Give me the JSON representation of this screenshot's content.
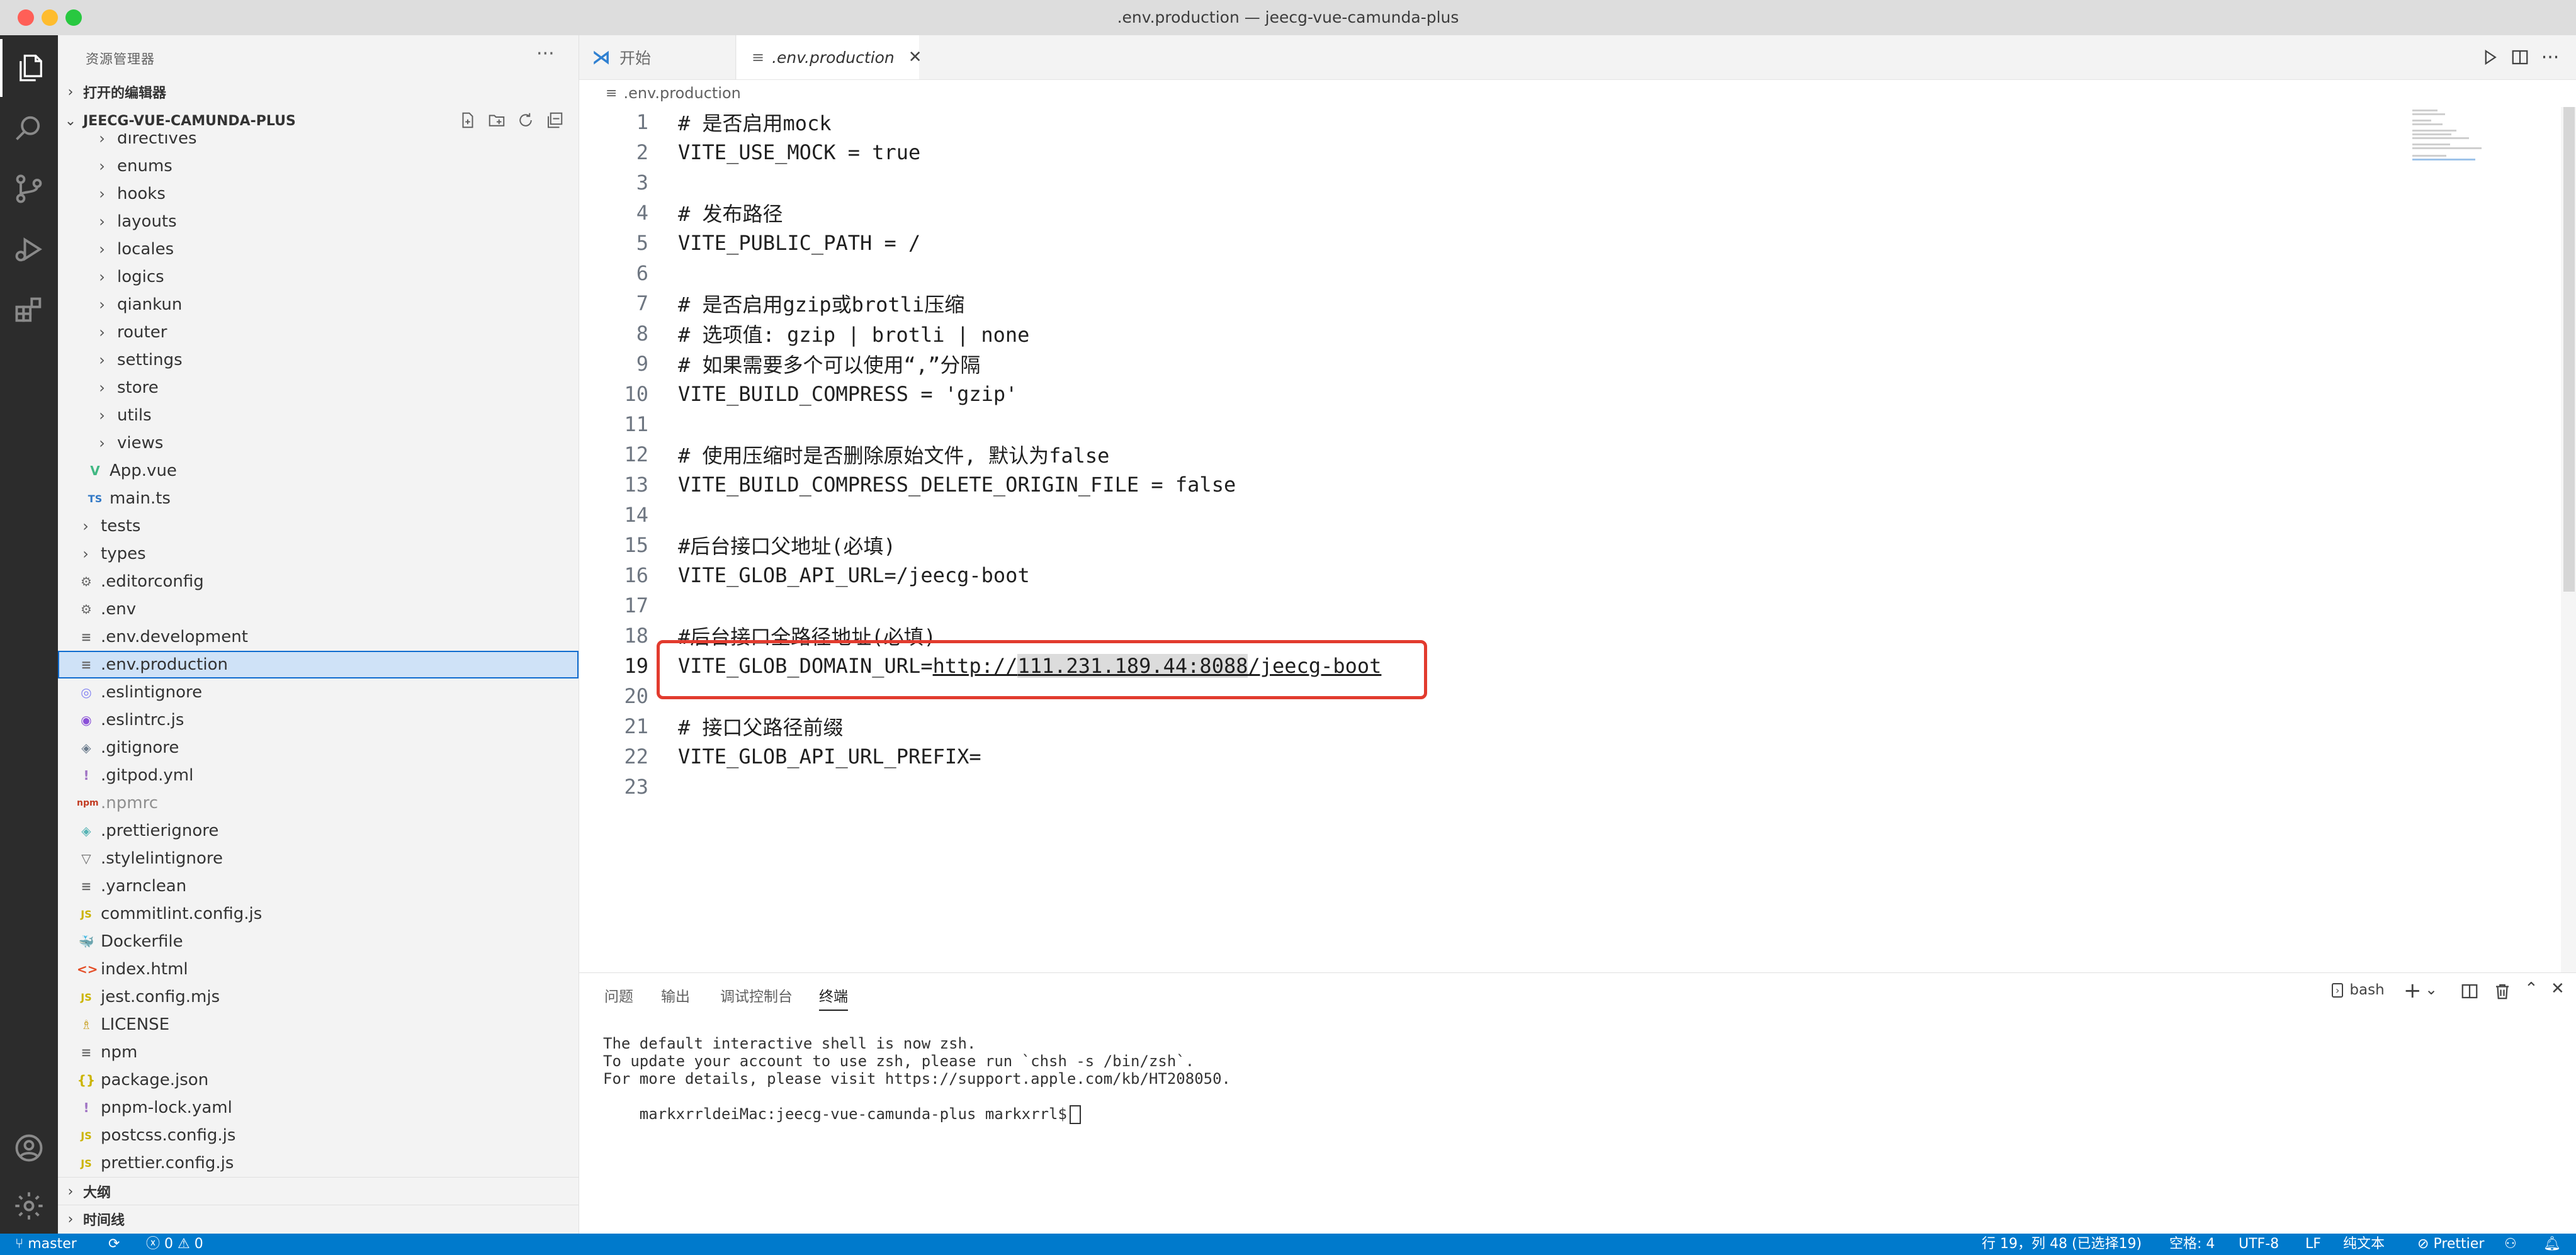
{
  "window": {
    "title": ".env.production — jeecg-vue-camunda-plus"
  },
  "colors": {
    "close": "#ff5f57",
    "minimize": "#febc2e",
    "zoom": "#28c840",
    "accent": "#007acc",
    "highlight_box": "#e23b2e"
  },
  "activity_bar": {
    "items": [
      "explorer-icon",
      "search-icon",
      "source-control-icon",
      "run-debug-icon",
      "extensions-icon",
      "account-icon",
      "settings-gear-icon"
    ]
  },
  "sidebar": {
    "title": "资源管理器",
    "more": "···",
    "open_editors": "打开的编辑器",
    "project": "JEECG-VUE-CAMUNDA-PLUS",
    "tree": [
      {
        "label": "directives",
        "type": "folder"
      },
      {
        "label": "enums",
        "type": "folder"
      },
      {
        "label": "hooks",
        "type": "folder"
      },
      {
        "label": "layouts",
        "type": "folder"
      },
      {
        "label": "locales",
        "type": "folder"
      },
      {
        "label": "logics",
        "type": "folder"
      },
      {
        "label": "qiankun",
        "type": "folder"
      },
      {
        "label": "router",
        "type": "folder"
      },
      {
        "label": "settings",
        "type": "folder"
      },
      {
        "label": "store",
        "type": "folder"
      },
      {
        "label": "utils",
        "type": "folder"
      },
      {
        "label": "views",
        "type": "folder"
      },
      {
        "label": "App.vue",
        "type": "vue",
        "icon": "V"
      },
      {
        "label": "main.ts",
        "type": "ts",
        "icon": "TS"
      },
      {
        "label": "tests",
        "type": "folder-root"
      },
      {
        "label": "types",
        "type": "folder-root"
      },
      {
        "label": ".editorconfig",
        "type": "gear",
        "icon": "⚙"
      },
      {
        "label": ".env",
        "type": "gear",
        "icon": "⚙"
      },
      {
        "label": ".env.development",
        "type": "text",
        "icon": "≡"
      },
      {
        "label": ".env.production",
        "type": "text",
        "icon": "≡",
        "selected": true
      },
      {
        "label": ".eslintignore",
        "type": "eslint",
        "icon": "◎"
      },
      {
        "label": ".eslintrc.js",
        "type": "eslint2",
        "icon": "◉"
      },
      {
        "label": ".gitignore",
        "type": "git",
        "icon": "◈"
      },
      {
        "label": ".gitpod.yml",
        "type": "yml",
        "icon": "!"
      },
      {
        "label": ".npmrc",
        "type": "npm",
        "icon": "npm"
      },
      {
        "label": ".prettierignore",
        "type": "prettier",
        "icon": "◈"
      },
      {
        "label": ".stylelintignore",
        "type": "stylelint",
        "icon": "▽"
      },
      {
        "label": ".yarnclean",
        "type": "text",
        "icon": "≡"
      },
      {
        "label": "commitlint.config.js",
        "type": "js",
        "icon": "JS"
      },
      {
        "label": "Dockerfile",
        "type": "docker",
        "icon": "🐳"
      },
      {
        "label": "index.html",
        "type": "html",
        "icon": "<>"
      },
      {
        "label": "jest.config.mjs",
        "type": "js",
        "icon": "JS"
      },
      {
        "label": "LICENSE",
        "type": "license",
        "icon": "♗"
      },
      {
        "label": "npm",
        "type": "text",
        "icon": "≡"
      },
      {
        "label": "package.json",
        "type": "json",
        "icon": "{}"
      },
      {
        "label": "pnpm-lock.yaml",
        "type": "yml",
        "icon": "!"
      },
      {
        "label": "postcss.config.js",
        "type": "js",
        "icon": "JS"
      },
      {
        "label": "prettier.config.js",
        "type": "js",
        "icon": "JS"
      }
    ],
    "outline": "大纲",
    "timeline": "时间线"
  },
  "tabs": [
    {
      "label": "开始",
      "active": false
    },
    {
      "label": ".env.production",
      "active": true
    }
  ],
  "breadcrumb": ".env.production",
  "editor": {
    "lines": [
      "# 是否启用mock",
      "VITE_USE_MOCK = true",
      "",
      "# 发布路径",
      "VITE_PUBLIC_PATH = /",
      "",
      "# 是否启用gzip或brotli压缩",
      "# 选项值: gzip | brotli | none",
      "# 如果需要多个可以使用“,”分隔",
      "VITE_BUILD_COMPRESS = 'gzip'",
      "",
      "# 使用压缩时是否删除原始文件, 默认为false",
      "VITE_BUILD_COMPRESS_DELETE_ORIGIN_FILE = false",
      "",
      "#后台接口父地址(必填)",
      "VITE_GLOB_API_URL=/jeecg-boot",
      "",
      "#后台接口全路径地址(必填)",
      "",
      "",
      "# 接口父路径前缀",
      "VITE_GLOB_API_URL_PREFIX=",
      ""
    ],
    "line19": {
      "key": "VITE_GLOB_DOMAIN_URL=",
      "url_prefix": "http://",
      "url_host": "111.231.189.44:8088",
      "url_suffix": "/jeecg-boot"
    },
    "active_line": 19
  },
  "panel": {
    "tabs": [
      "问题",
      "输出",
      "调试控制台",
      "终端"
    ],
    "active_tab": "终端",
    "shell": "bash",
    "terminal": [
      "The default interactive shell is now zsh.",
      "To update your account to use zsh, please run `chsh -s /bin/zsh`.",
      "For more details, please visit https://support.apple.com/kb/HT208050.",
      "markxrrldeiMac:jeecg-vue-camunda-plus markxrrl$"
    ]
  },
  "status": {
    "branch": "master",
    "errors": "0",
    "warnings": "0",
    "position": "行 19，列 48 (已选择19)",
    "spaces": "空格: 4",
    "encoding": "UTF-8",
    "eol": "LF",
    "language": "纯文本",
    "formatter": "Prettier"
  }
}
